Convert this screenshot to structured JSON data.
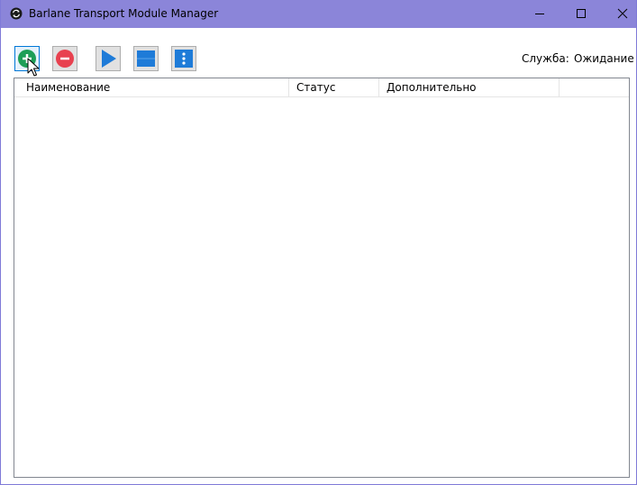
{
  "window": {
    "title": "Barlane Transport Module Manager",
    "titlebar_color": "#8b85d9",
    "app_icon": "sync-circle-icon",
    "controls": {
      "minimize_icon": "minimize-icon",
      "maximize_icon": "maximize-icon",
      "close_icon": "close-icon"
    }
  },
  "toolbar": {
    "buttons": [
      {
        "icon": "add-circle-icon",
        "color": "#1e9e57"
      },
      {
        "icon": "remove-circle-icon",
        "color": "#e8414f"
      },
      {
        "icon": "play-icon",
        "color": "#1e7bd8"
      },
      {
        "icon": "stop-icon",
        "color": "#1e7bd8"
      },
      {
        "icon": "more-vertical-icon",
        "color": "#1e7bd8"
      }
    ]
  },
  "service": {
    "label": "Служба:",
    "status": "Ожидание"
  },
  "list": {
    "columns": [
      "Наименование",
      "Статус",
      "Дополнительно"
    ],
    "rows": []
  }
}
